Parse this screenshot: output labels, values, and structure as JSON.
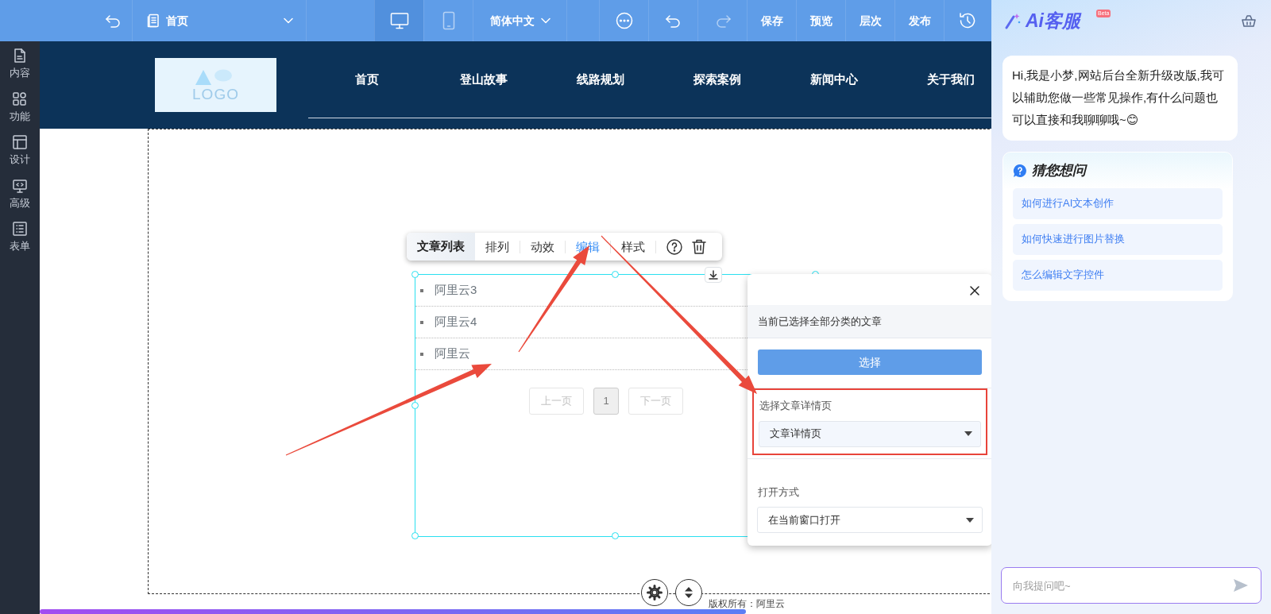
{
  "topbar": {
    "page_select": "首页",
    "devices": [
      {
        "kind": "desktop",
        "selected": true
      },
      {
        "kind": "tablet",
        "selected": false
      }
    ],
    "language": "简体中文",
    "actions": [
      "保存",
      "预览",
      "层次",
      "发布"
    ]
  },
  "sidebar": {
    "items": [
      {
        "kind": "content",
        "label": "内容"
      },
      {
        "kind": "function",
        "label": "功能"
      },
      {
        "kind": "design",
        "label": "设计"
      },
      {
        "kind": "advanced",
        "label": "高级"
      },
      {
        "kind": "form",
        "label": "表单"
      }
    ]
  },
  "site_header": {
    "logo": "LOGO",
    "nav": [
      "首页",
      "登山故事",
      "线路规划",
      "探索案例",
      "新闻中心",
      "关于我们"
    ]
  },
  "widget_toolbar": {
    "title": "文章列表",
    "tabs": [
      {
        "label": "排列",
        "selected": false
      },
      {
        "label": "动效",
        "selected": false
      },
      {
        "label": "编辑",
        "selected": true
      },
      {
        "label": "样式",
        "selected": false
      }
    ]
  },
  "article_list": {
    "items": [
      "阿里云3",
      "阿里云4",
      "阿里云"
    ],
    "pagination": {
      "prev": "上一页",
      "page": "1",
      "next": "下一页"
    }
  },
  "settings_panel": {
    "info": "当前已选择全部分类的文章",
    "select_button": "选择",
    "fields": [
      {
        "label": "选择文章详情页",
        "value": "文章详情页",
        "highlighted": true
      },
      {
        "label": "打开方式",
        "value": "在当前窗口打开",
        "highlighted": false
      }
    ]
  },
  "footer": "版权所有：阿里云",
  "assistant": {
    "title": "Ai客服",
    "badge": "Beta",
    "greeting": "Hi,我是小梦,网站后台全新升级改版,我可以辅助您做一些常见操作,有什么问题也可以直接和我聊聊哦~😊",
    "suggestions_title": "猜您想问",
    "suggestions": [
      "如何进行AI文本创作",
      "如何快速进行图片替换",
      "怎么编辑文字控件"
    ],
    "input_placeholder": "向我提问吧~"
  }
}
